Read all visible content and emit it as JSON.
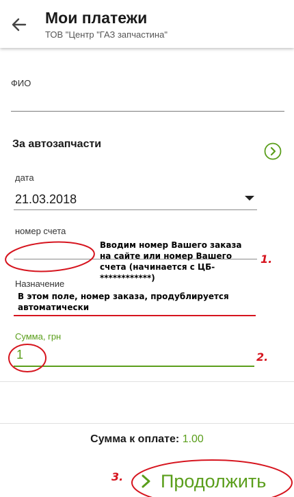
{
  "header": {
    "title": "Мои платежи",
    "subtitle": "ТОВ \"Центр \"ГАЗ запчастина\""
  },
  "form": {
    "fio_label": "ФИО",
    "fio_value": "",
    "section_title": "За автозапчасти",
    "date_label": "дата",
    "date_value": "21.03.2018",
    "account_label": "номер счета",
    "account_value": "",
    "purpose_label": "Назначение",
    "sum_label": "Сумма, грн",
    "sum_value": "1"
  },
  "annotations": {
    "note1": "Вводим номер Вашего заказа на сайте или номер Вашего счета (начинается с ЦБ-************)",
    "note2": "В этом поле, номер заказа, продублируется автоматически",
    "num1": "1.",
    "num2": "2.",
    "num3": "3."
  },
  "footer": {
    "total_label": "Сумма к оплате:",
    "total_value": "1.00",
    "continue_label": "Продолжить"
  },
  "colors": {
    "accent_green": "#5a9e1b",
    "annotation_red": "#d6141e"
  },
  "icons": {
    "back": "arrow-left-icon",
    "next": "chevron-right-circle-icon",
    "dropdown": "triangle-down-icon",
    "continue": "chevron-right-icon"
  }
}
